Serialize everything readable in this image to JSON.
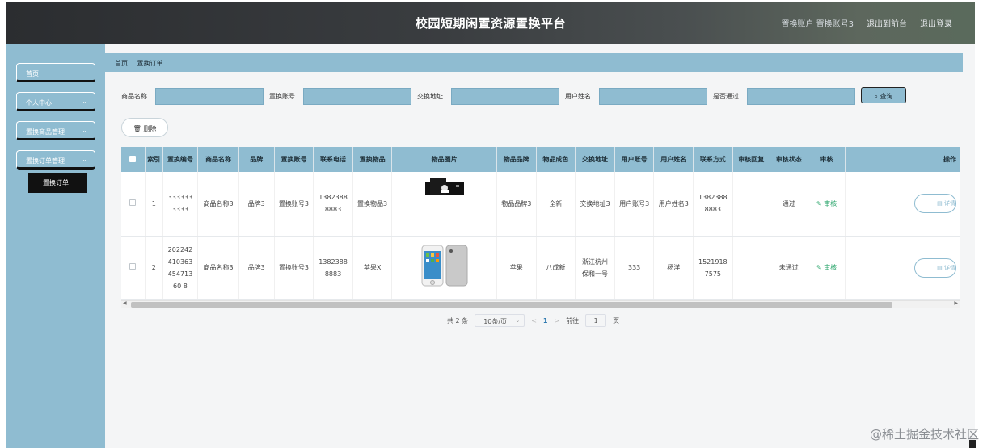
{
  "app": {
    "title": "校园短期闲置资源置换平台",
    "user_label": "置换账户 置换账号3",
    "front_link": "退出到前台",
    "logout_link": "退出登录"
  },
  "sidebar": {
    "items": [
      {
        "label": "首页",
        "chevron": ""
      },
      {
        "label": "个人中心",
        "chevron": "⌄"
      },
      {
        "label": "置换商品管理",
        "chevron": "⌄"
      },
      {
        "label": "置换订单管理",
        "chevron": "⌄"
      }
    ],
    "subitem": "置换订单"
  },
  "breadcrumb": {
    "home": "首页",
    "current": "置换订单"
  },
  "search": {
    "fields": [
      {
        "label": "商品名称",
        "value": ""
      },
      {
        "label": "置换账号",
        "value": ""
      },
      {
        "label": "交换地址",
        "value": ""
      },
      {
        "label": "用户姓名",
        "value": ""
      },
      {
        "label": "是否通过",
        "value": ""
      }
    ],
    "query_label": "查询",
    "query_icon": "search-icon"
  },
  "toolbar": {
    "delete_label": "删除",
    "delete_icon": "trash-icon"
  },
  "table": {
    "headers": [
      "",
      "索引",
      "置换编号",
      "商品名称",
      "品牌",
      "置换账号",
      "联系电话",
      "置换物品",
      "物品图片",
      "物品品牌",
      "物品成色",
      "交换地址",
      "用户账号",
      "用户姓名",
      "联系方式",
      "审核回复",
      "审核状态",
      "审核",
      "操作"
    ],
    "rows": [
      {
        "index": "1",
        "code": "3333333333",
        "name": "商品名称3",
        "brand": "品牌3",
        "account": "置换账号3",
        "phone": "13823888883",
        "item": "置换物品3",
        "image": "product-photo",
        "item_brand": "物品品牌3",
        "condition": "全新",
        "address": "交换地址3",
        "user_account": "用户账号3",
        "user_name": "用户姓名3",
        "contact": "13823888883",
        "reply": "",
        "status": "通过",
        "audit": "审核",
        "detail": "详情"
      },
      {
        "index": "2",
        "code": "20224241036345471360 8",
        "name": "商品名称3",
        "brand": "品牌3",
        "account": "置换账号3",
        "phone": "13823888883",
        "item": "苹果X",
        "image": "iphone-photo",
        "item_brand": "苹果",
        "condition": "八成新",
        "address": "浙江杭州保和一号",
        "user_account": "333",
        "user_name": "杨洋",
        "contact": "15219187575",
        "reply": "",
        "status": "未通过",
        "audit": "审核",
        "detail": "详情"
      }
    ]
  },
  "pagination": {
    "total": "共 2 条",
    "page_size": "10条/页",
    "prev": "<",
    "current": "1",
    "next": ">",
    "goto_label": "前往",
    "goto_value": "1",
    "page_unit": "页"
  },
  "watermark": "@稀土掘金技术社区",
  "colors": {
    "accent": "#8fbcd1",
    "header_dark": "#2b2d30",
    "approved_green": "#2aa56b"
  }
}
